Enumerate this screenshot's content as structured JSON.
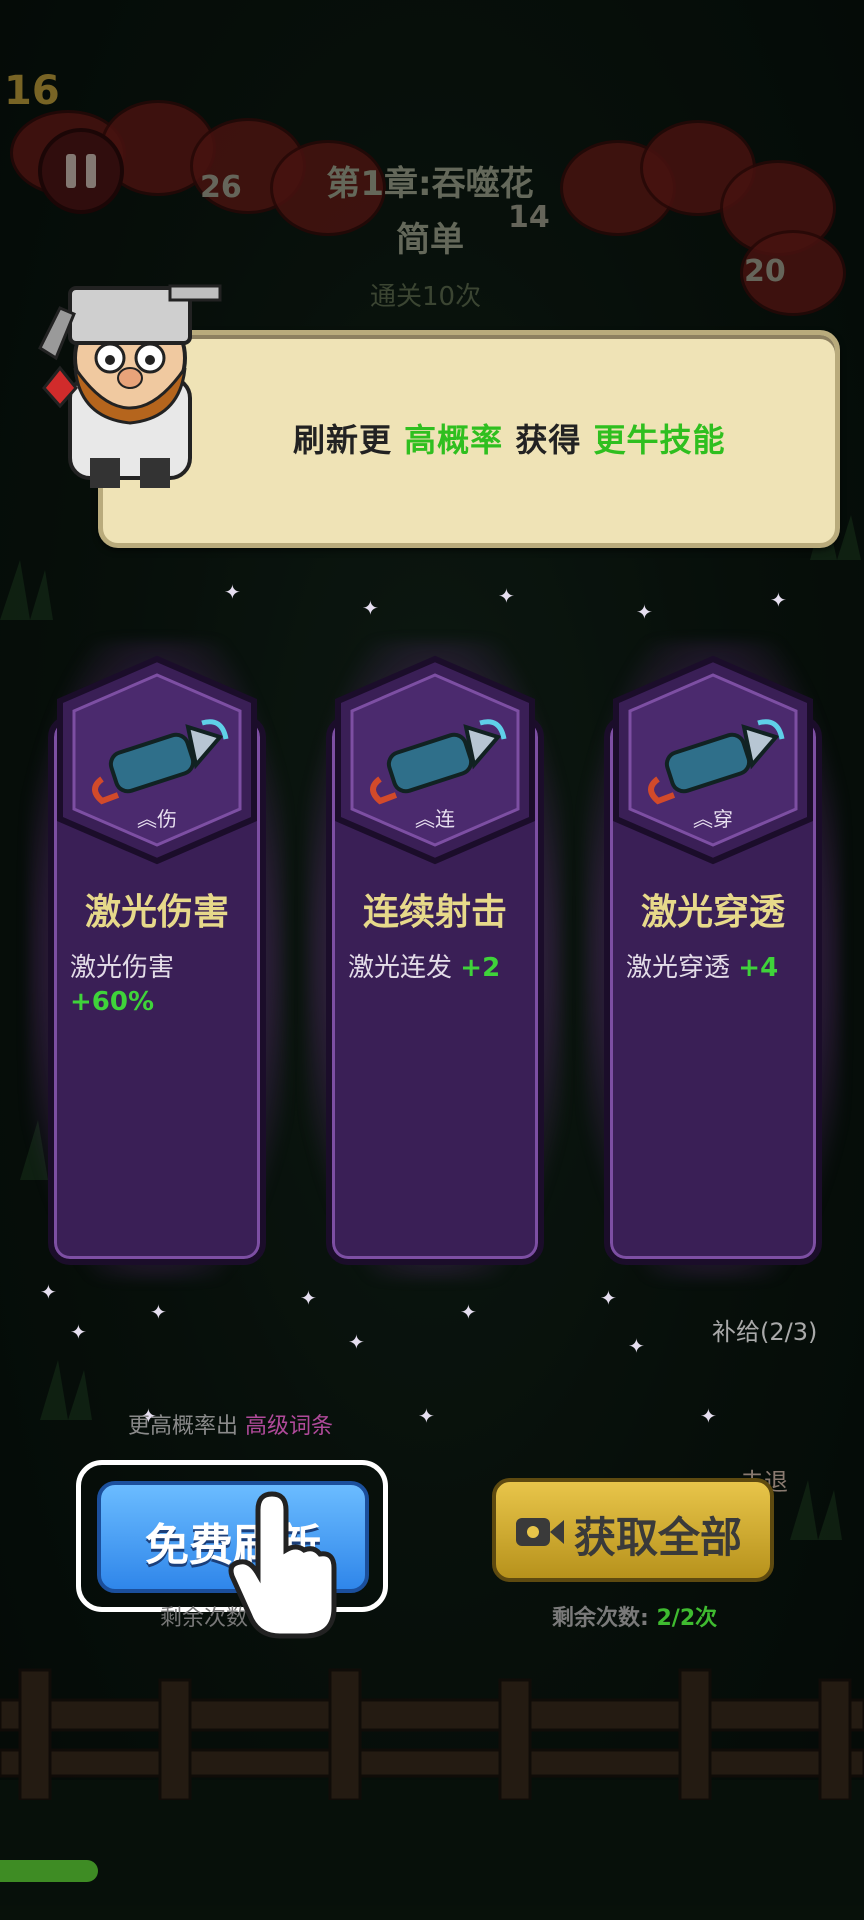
{
  "hud": {
    "wave": "16",
    "left_count": "26",
    "mid_count": "14",
    "right_count": "20",
    "chapter": "第1章:吞噬花",
    "difficulty": "简单",
    "faint": "通关10次"
  },
  "tip": {
    "prefix": "刷新更",
    "highlight1": "高概率",
    "middle": "获得",
    "highlight2": "更牛技能"
  },
  "cards": [
    {
      "name": "激光伤害",
      "tag": "︽伤",
      "desc": "激光伤害",
      "bonus": "+60%"
    },
    {
      "name": "连续射击",
      "tag": "︽连",
      "desc": "激光连发",
      "bonus": "+2"
    },
    {
      "name": "激光穿透",
      "tag": "︽穿",
      "desc": "激光穿透",
      "bonus": "+4"
    }
  ],
  "bottom": {
    "hint_prefix": "更高概率出",
    "hint_highlight": "高级词条",
    "free_refresh": "免费刷新",
    "remain_left": "剩余次数",
    "get_all": "获取全部",
    "remain_right_label": "剩余次数:",
    "remain_right_value": "2/2次",
    "supply": "补给(2/3)",
    "retreat": "击退"
  },
  "colors": {
    "accent_green": "#2fbf1f",
    "card_purple": "#3a1f56",
    "blue_button": "#2f86ea",
    "gold_button": "#e8c54a"
  }
}
